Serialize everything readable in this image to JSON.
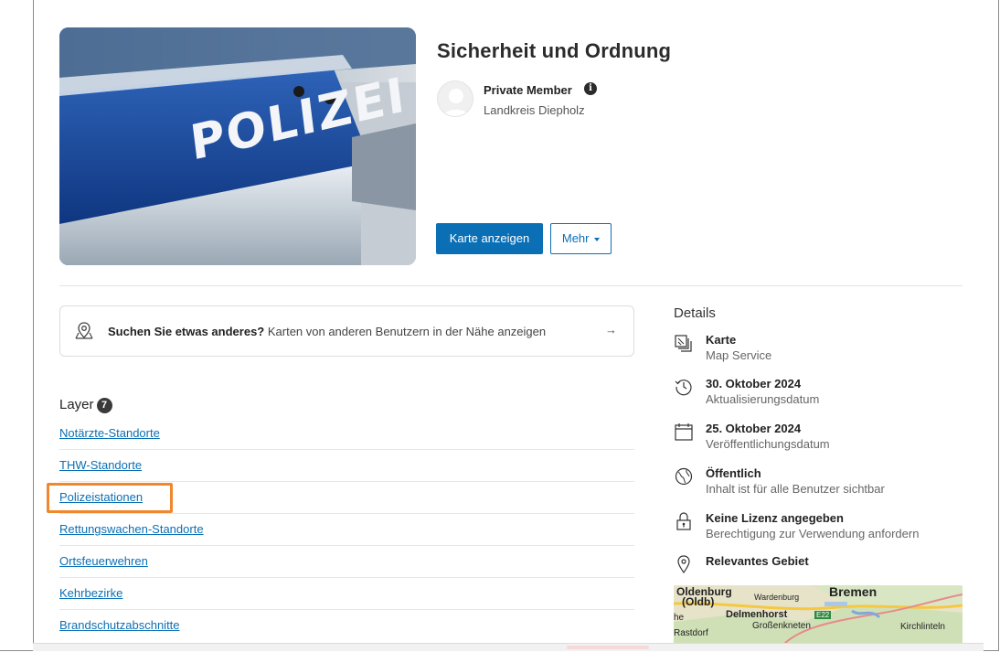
{
  "item": {
    "title": "Sicherheit und Ordnung",
    "hero_text": "POLIZEI",
    "owner": {
      "name": "Private Member",
      "info": "i",
      "organization": "Landkreis Diepholz"
    }
  },
  "actions": {
    "primary_label": "Karte anzeigen",
    "more_label": "Mehr"
  },
  "search_prompt": {
    "bold": "Suchen Sie etwas anderes?",
    "text": " Karten von anderen Benutzern in der Nähe anzeigen",
    "arrow": "→"
  },
  "layers": {
    "heading": "Layer",
    "count": "7",
    "items": [
      {
        "label": "Notärzte-Standorte"
      },
      {
        "label": "THW-Standorte"
      },
      {
        "label": "Polizeistationen"
      },
      {
        "label": "Rettungswachen-Standorte"
      },
      {
        "label": "Ortsfeuerwehren"
      },
      {
        "label": "Kehrbezirke"
      },
      {
        "label": "Brandschutzabschnitte"
      }
    ]
  },
  "details": {
    "heading": "Details",
    "items": [
      {
        "icon": "map-layers-icon",
        "title": "Karte",
        "sub": "Map Service"
      },
      {
        "icon": "history-clock-icon",
        "title": "30. Oktober 2024",
        "sub": "Aktualisierungsdatum"
      },
      {
        "icon": "calendar-icon",
        "title": "25. Oktober 2024",
        "sub": "Veröffentlichungsdatum"
      },
      {
        "icon": "globe-icon",
        "title": "Öffentlich",
        "sub": "Inhalt ist für alle Benutzer sichtbar"
      },
      {
        "icon": "lock-icon",
        "title": "Keine Lizenz angegeben",
        "sub": "Berechtigung zur Verwendung anfordern"
      },
      {
        "icon": "location-pin-icon",
        "title": "Relevantes Gebiet",
        "sub": ""
      }
    ]
  },
  "extent_map": {
    "labels": [
      "Oldenburg",
      "(Oldb)",
      "Wardenburg",
      "Bremen",
      "Delmenhorst",
      "E22",
      "Großenkneten",
      "Kirchlinteln",
      "he",
      "Rastdorf"
    ]
  },
  "colors": {
    "accent": "#0b6fb5",
    "highlight": "#f0872f"
  }
}
